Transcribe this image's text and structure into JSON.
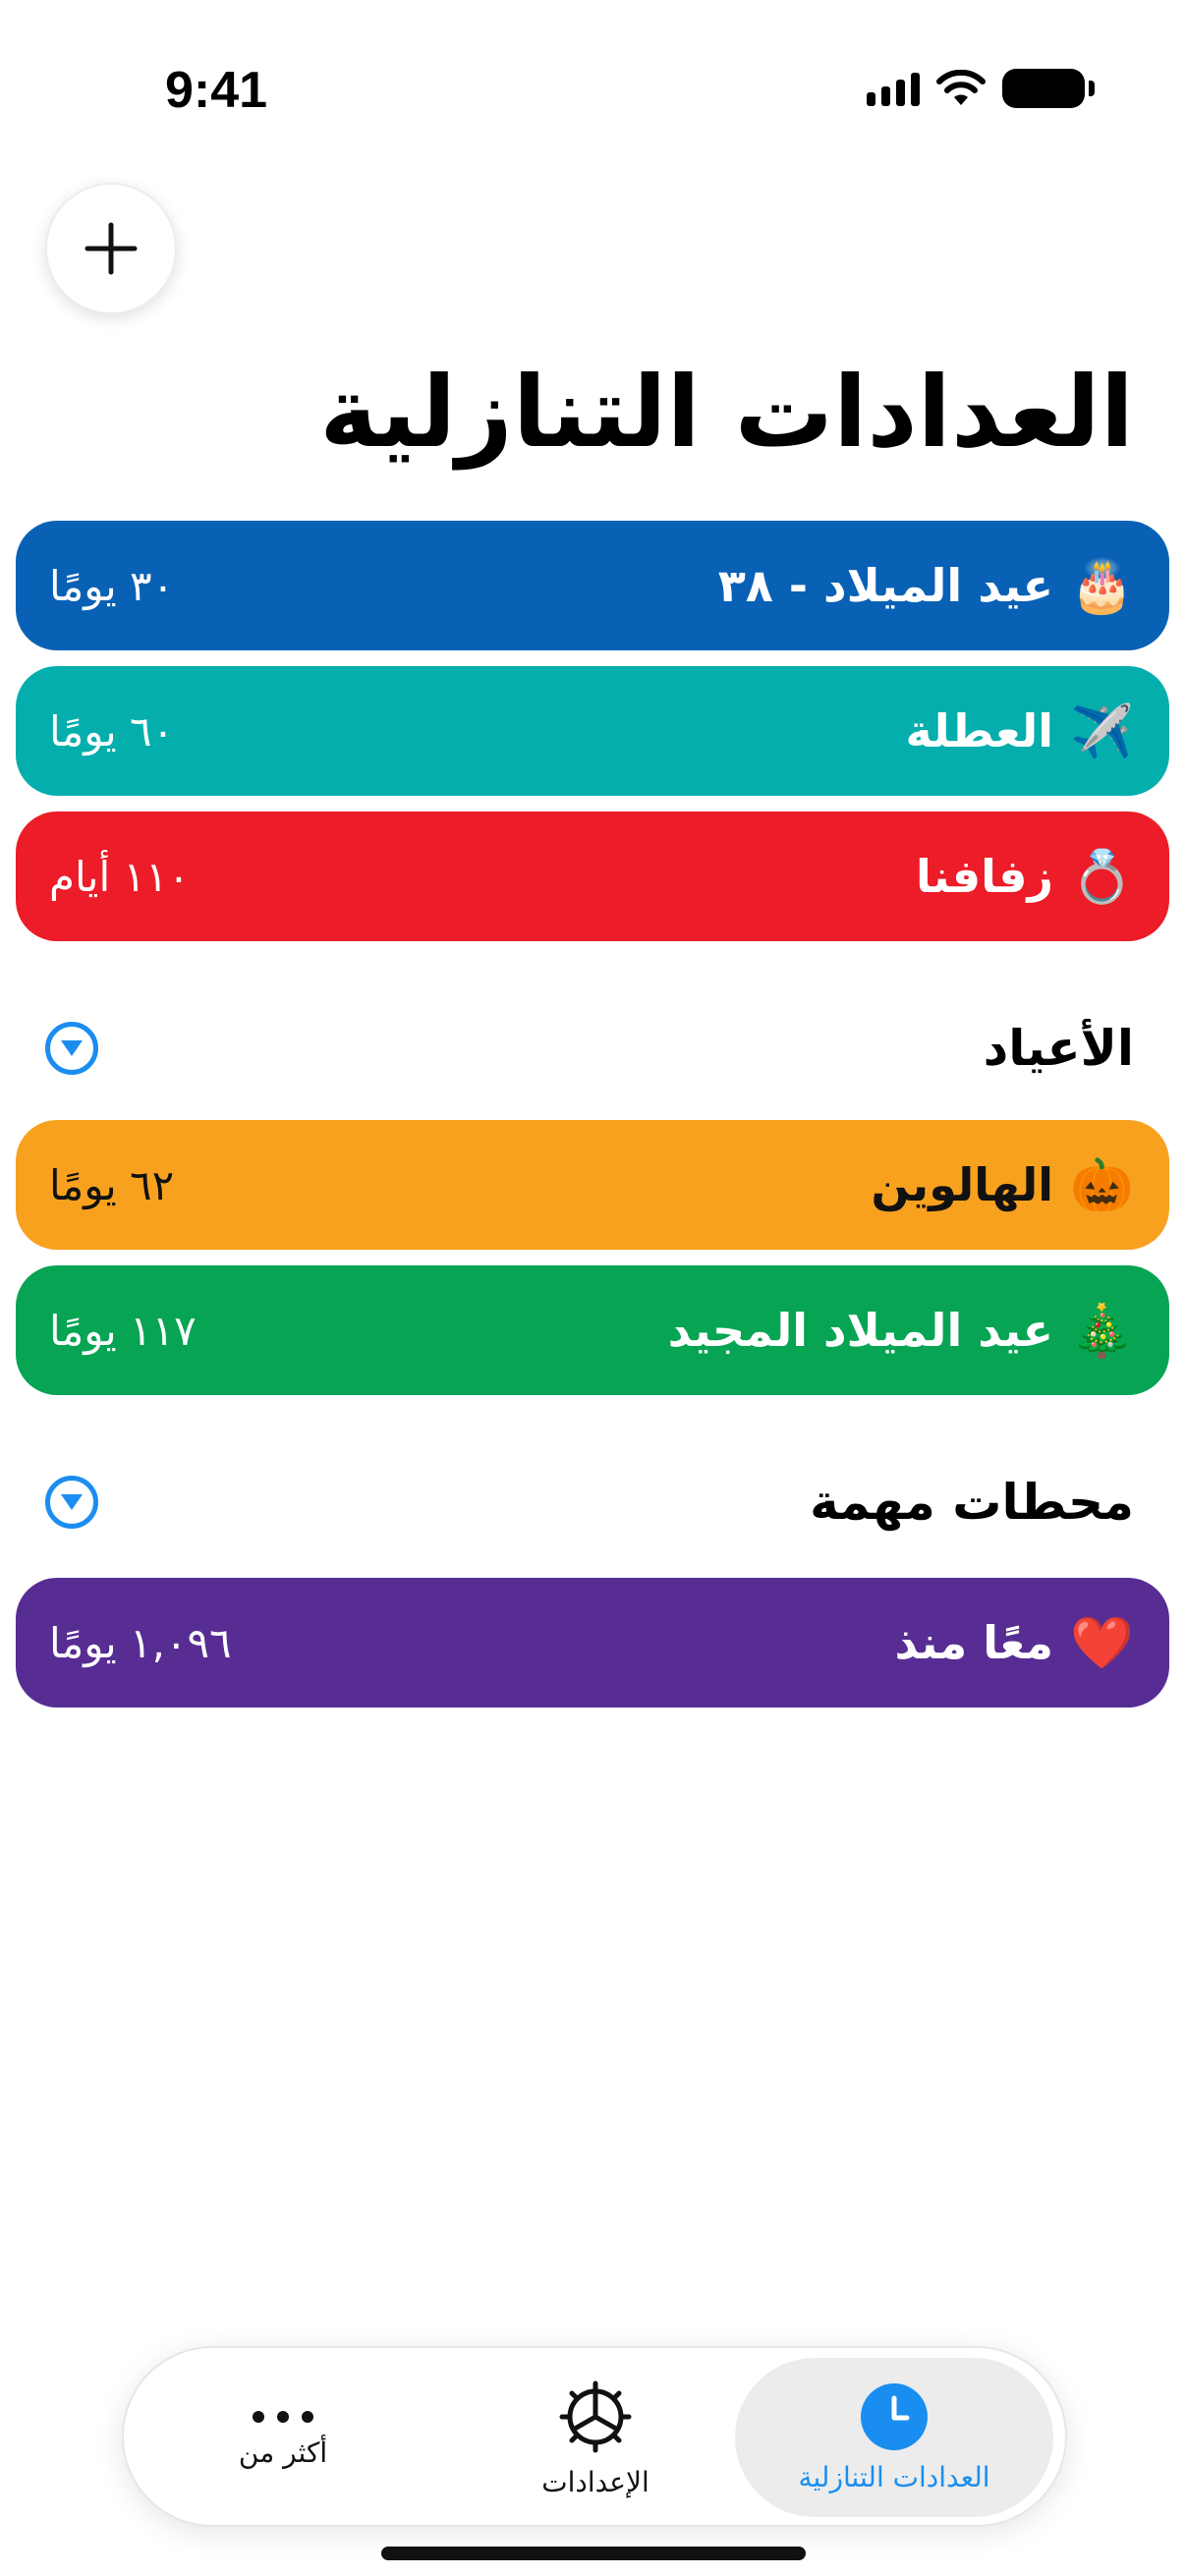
{
  "status_bar": {
    "time": "9:41"
  },
  "page": {
    "title": "العدادات التنازلية"
  },
  "countdowns": [
    {
      "name": "عيد الميلاد - ٣٨",
      "emoji": "🎂",
      "count": "٣٠ يومًا",
      "color": "#0961B5"
    },
    {
      "name": "العطلة",
      "emoji": "✈️",
      "count": "٦٠ يومًا",
      "color": "#04AEAC"
    },
    {
      "name": "زفافنا",
      "emoji": "💍",
      "count": "١١٠ أيام",
      "color": "#EC1C28"
    }
  ],
  "sections": [
    {
      "title": "الأعياد",
      "items": [
        {
          "name": "الهالوين",
          "emoji": "🎃",
          "count": "٦٢ يومًا",
          "color": "#F8A11F"
        },
        {
          "name": "عيد الميلاد المجيد",
          "emoji": "🎄",
          "count": "١١٧ يومًا",
          "color": "#07A454"
        }
      ]
    },
    {
      "title": "محطات مهمة",
      "items": [
        {
          "name": "معًا منذ",
          "emoji": "❤️",
          "count": "١,٠٩٦ يومًا",
          "color": "#572D93"
        }
      ]
    }
  ],
  "tab_bar": {
    "tabs": [
      {
        "label": "العدادات التنازلية",
        "icon": "clock-icon",
        "active": true
      },
      {
        "label": "الإعدادات",
        "icon": "gear-icon",
        "active": false
      },
      {
        "label": "أكثر من",
        "icon": "more-icon",
        "active": false
      }
    ],
    "accent": "#1A8EF0"
  }
}
